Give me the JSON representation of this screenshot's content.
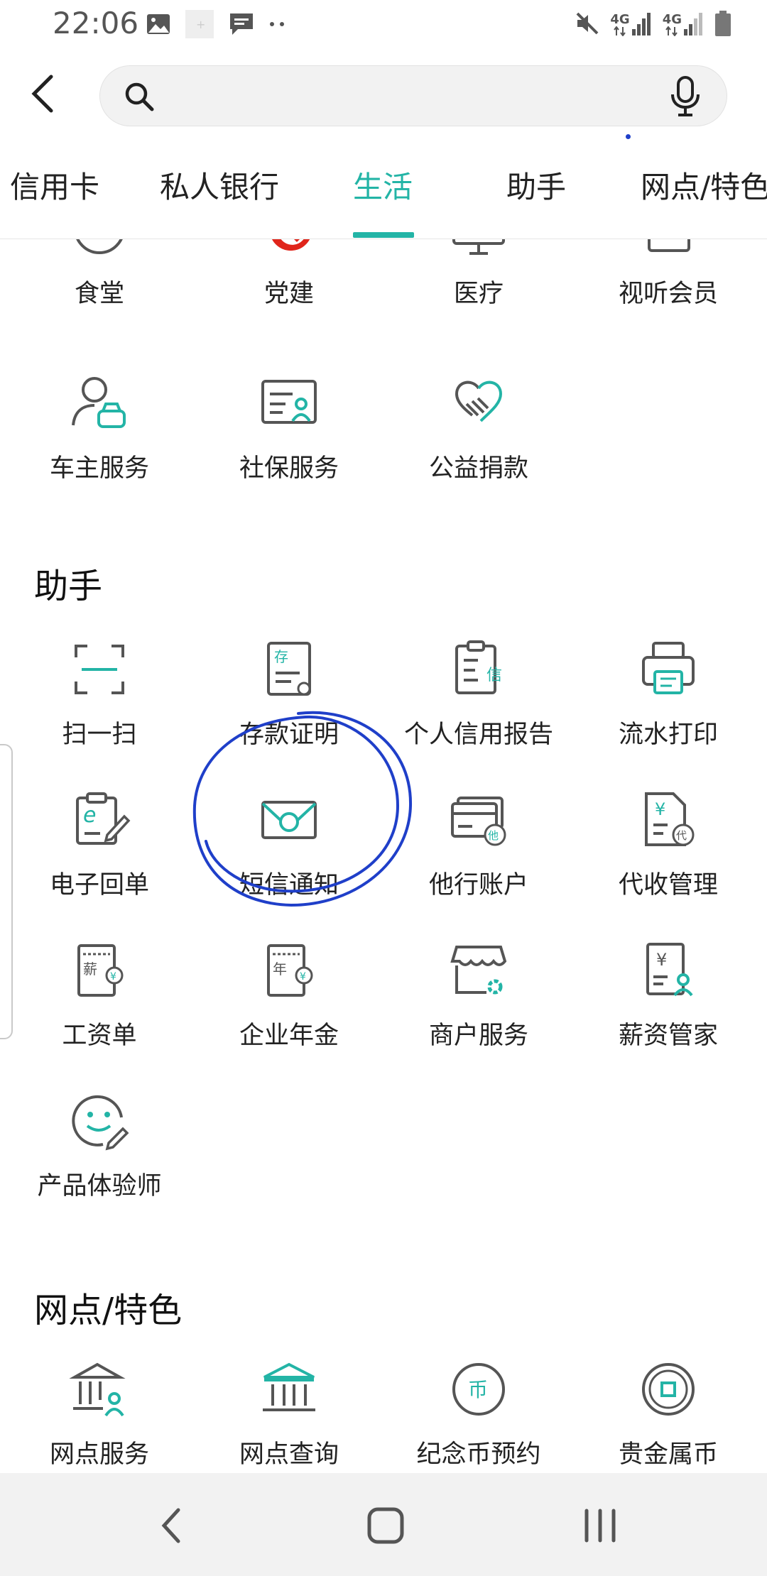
{
  "status_bar": {
    "time": "22:06",
    "network_1": "4G",
    "network_2": "4G"
  },
  "search": {
    "placeholder": "",
    "value": ""
  },
  "tabs": [
    {
      "label": "信用卡"
    },
    {
      "label": "私人银行"
    },
    {
      "label": "生活",
      "active": true
    },
    {
      "label": "助手"
    },
    {
      "label": "网点/特色"
    }
  ],
  "life_partial_row": [
    "食堂",
    "党建",
    "医疗",
    "视听会员"
  ],
  "life_row2": [
    "车主服务",
    "社保服务",
    "公益捐款"
  ],
  "assistant": {
    "title": "助手",
    "items": [
      "扫一扫",
      "存款证明",
      "个人信用报告",
      "流水打印",
      "电子回单",
      "短信通知",
      "他行账户",
      "代收管理",
      "工资单",
      "企业年金",
      "商户服务",
      "薪资管家",
      "产品体验师"
    ]
  },
  "outlet": {
    "title": "网点/特色",
    "items": [
      "网点服务",
      "网点查询",
      "纪念币预约",
      "贵金属币"
    ]
  },
  "icon_glyphs": {
    "deposit": "存",
    "credit": "信",
    "other_bank": "他",
    "agent": "代",
    "salary": "薪",
    "year": "年",
    "yen": "¥",
    "coin": "币"
  },
  "colors": {
    "accent": "#23b4a6",
    "icon_gray": "#555555",
    "annotation": "#1f3fc9",
    "party_red": "#e0251b"
  }
}
